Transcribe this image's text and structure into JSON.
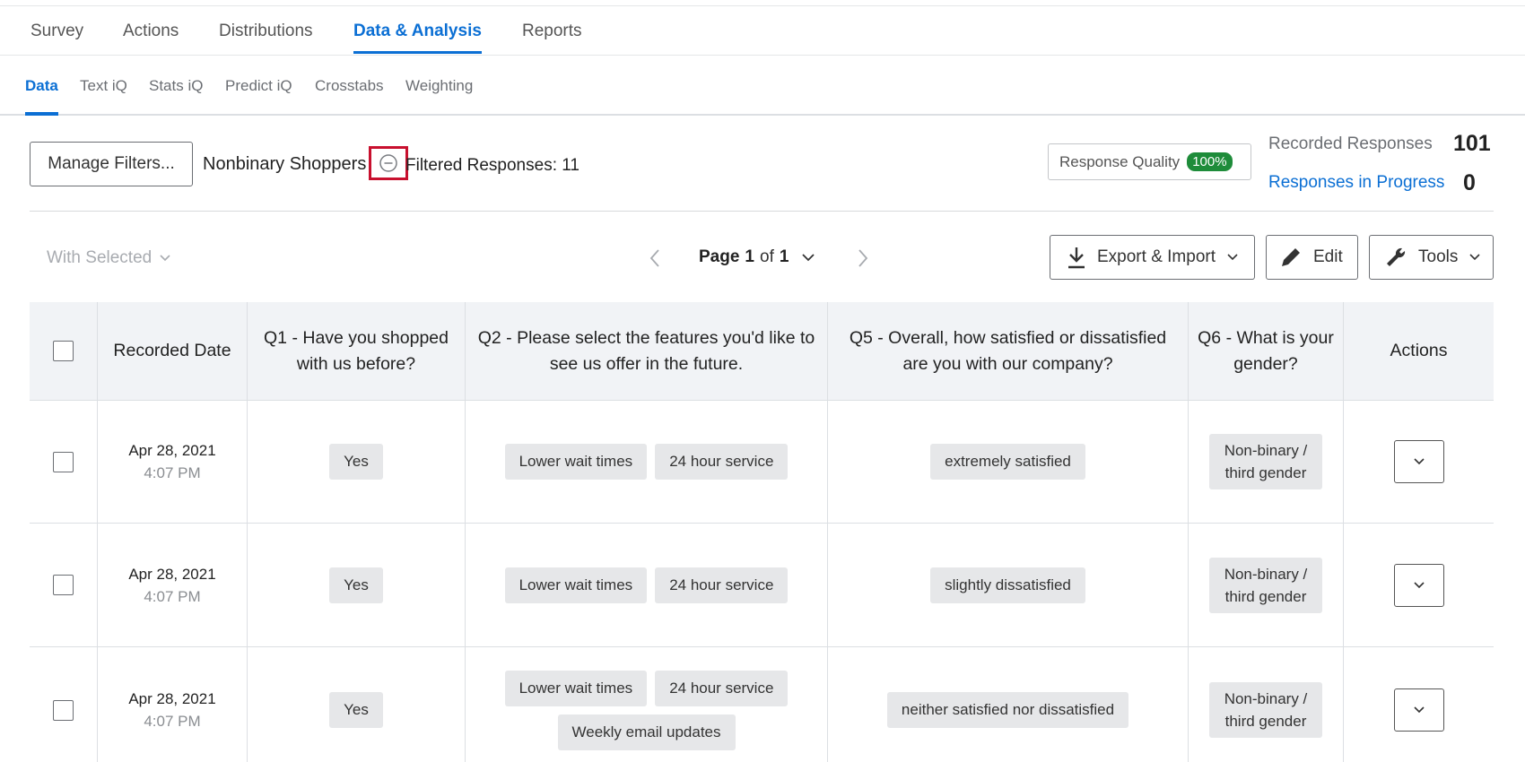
{
  "top_nav": {
    "tabs": [
      "Survey",
      "Actions",
      "Distributions",
      "Data & Analysis",
      "Reports"
    ],
    "active": "Data & Analysis"
  },
  "sub_nav": {
    "tabs": [
      "Data",
      "Text iQ",
      "Stats iQ",
      "Predict iQ",
      "Crosstabs",
      "Weighting"
    ],
    "active": "Data"
  },
  "filters": {
    "manage_label": "Manage Filters...",
    "active_filter": "Nonbinary Shoppers",
    "filtered_label": "Filtered Responses: 11"
  },
  "response_quality": {
    "label": "Response Quality",
    "badge": "100%"
  },
  "stats": {
    "recorded_label": "Recorded Responses",
    "recorded_value": "101",
    "in_progress_label": "Responses in Progress",
    "in_progress_value": "0"
  },
  "toolbar": {
    "with_selected": "With Selected",
    "page_word": "Page",
    "page_current": "1",
    "page_of": "of",
    "page_total": "1",
    "export_label": "Export & Import",
    "edit_label": "Edit",
    "tools_label": "Tools"
  },
  "table": {
    "headers": [
      "Recorded Date",
      "Q1 - Have you shopped with us before?",
      "Q2 - Please select the features you'd like to see us offer in the future.",
      "Q5 - Overall, how satisfied or dissatisfied are you with our company?",
      "Q6 - What is your gender?",
      "Actions"
    ],
    "rows": [
      {
        "date": "Apr 28, 2021",
        "time": "4:07 PM",
        "q1": "Yes",
        "q2": [
          "Lower wait times",
          "24 hour service"
        ],
        "q5": "extremely satisfied",
        "q6": "Non-binary / third gender"
      },
      {
        "date": "Apr 28, 2021",
        "time": "4:07 PM",
        "q1": "Yes",
        "q2": [
          "Lower wait times",
          "24 hour service"
        ],
        "q5": "slightly dissatisfied",
        "q6": "Non-binary / third gender"
      },
      {
        "date": "Apr 28, 2021",
        "time": "4:07 PM",
        "q1": "Yes",
        "q2": [
          "Lower wait times",
          "24 hour service",
          "Weekly email updates"
        ],
        "q5": "neither satisfied nor dissatisfied",
        "q6": "Non-binary / third gender"
      }
    ]
  },
  "colors": {
    "accent": "#0b6fd4",
    "highlight": "#c8102e",
    "quality_badge": "#1e8c3a"
  }
}
